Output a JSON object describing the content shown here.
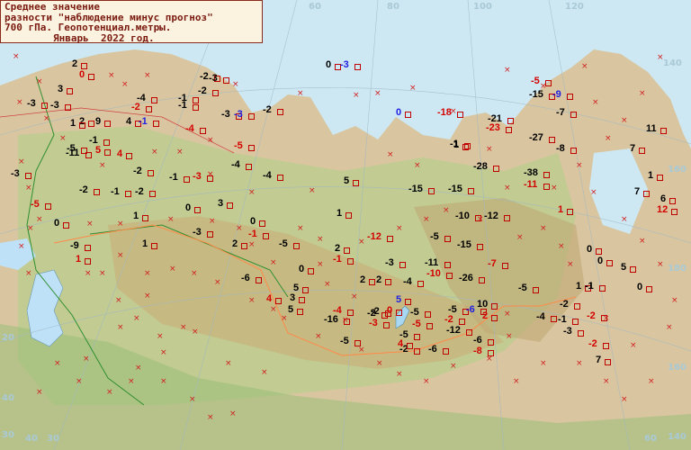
{
  "legend": {
    "line1": "Среднее значение",
    "line2": "разности \"наблюдение минус прогноз\"",
    "line3": "700 гПа. Геопотенциал.метры.",
    "line4": "Январь  2022 год."
  },
  "coordinate_labels": [
    "60",
    "80",
    "100",
    "120",
    "140",
    "160",
    "180",
    "160",
    "140",
    "40",
    "30",
    "20",
    "30",
    "40",
    "60"
  ],
  "observations": [
    {
      "v": "2",
      "c": "black"
    },
    {
      "v": "0",
      "c": "red"
    },
    {
      "v": "3",
      "c": "black"
    },
    {
      "v": "-3",
      "c": "black"
    },
    {
      "v": "-2",
      "c": "black"
    },
    {
      "v": "-3",
      "c": "black"
    },
    {
      "v": "-2",
      "c": "black"
    },
    {
      "v": "-1",
      "c": "black"
    },
    {
      "v": "-4",
      "c": "black"
    },
    {
      "v": "-3",
      "c": "black"
    },
    {
      "v": "2",
      "c": "black"
    },
    {
      "v": "9",
      "c": "black"
    },
    {
      "v": "4",
      "c": "black"
    },
    {
      "v": "-1",
      "c": "blue"
    },
    {
      "v": "-2",
      "c": "red"
    },
    {
      "v": "-1",
      "c": "black"
    },
    {
      "v": "-4",
      "c": "red"
    },
    {
      "v": "-3",
      "c": "black"
    },
    {
      "v": "-3",
      "c": "blue"
    },
    {
      "v": "-2",
      "c": "black"
    },
    {
      "v": "0",
      "c": "black"
    },
    {
      "v": "-3",
      "c": "blue"
    },
    {
      "v": "-18",
      "c": "red"
    },
    {
      "v": "0",
      "c": "blue"
    },
    {
      "v": "-1",
      "c": "black"
    },
    {
      "v": "-1",
      "c": "black"
    },
    {
      "v": "5",
      "c": "red"
    },
    {
      "v": "-5",
      "c": "black"
    },
    {
      "v": "1",
      "c": "black"
    },
    {
      "v": "-11",
      "c": "black"
    },
    {
      "v": "4",
      "c": "red"
    },
    {
      "v": "-2",
      "c": "black"
    },
    {
      "v": "-1",
      "c": "black"
    },
    {
      "v": "-3",
      "c": "red"
    },
    {
      "v": "-4",
      "c": "black"
    },
    {
      "v": "-4",
      "c": "black"
    },
    {
      "v": "-5",
      "c": "red"
    },
    {
      "v": "-2",
      "c": "black"
    },
    {
      "v": "-1",
      "c": "black"
    },
    {
      "v": "-2",
      "c": "black"
    },
    {
      "v": "1",
      "c": "black"
    },
    {
      "v": "0",
      "c": "black"
    },
    {
      "v": "3",
      "c": "black"
    },
    {
      "v": "-5",
      "c": "red"
    },
    {
      "v": "5",
      "c": "black"
    },
    {
      "v": "0",
      "c": "black"
    },
    {
      "v": "-3",
      "c": "black"
    },
    {
      "v": "0",
      "c": "black"
    },
    {
      "v": "1",
      "c": "black"
    },
    {
      "v": "-1",
      "c": "red"
    },
    {
      "v": "-3",
      "c": "black"
    },
    {
      "v": "-9",
      "c": "black"
    },
    {
      "v": "1",
      "c": "red"
    },
    {
      "v": "2",
      "c": "black"
    },
    {
      "v": "-5",
      "c": "black"
    },
    {
      "v": "1",
      "c": "black"
    },
    {
      "v": "0",
      "c": "black"
    },
    {
      "v": "-6",
      "c": "black"
    },
    {
      "v": "5",
      "c": "black"
    },
    {
      "v": "4",
      "c": "red"
    },
    {
      "v": "3",
      "c": "black"
    },
    {
      "v": "5",
      "c": "black"
    },
    {
      "v": "2",
      "c": "black"
    },
    {
      "v": "-1",
      "c": "red"
    },
    {
      "v": "2",
      "c": "black"
    },
    {
      "v": "-2",
      "c": "black"
    },
    {
      "v": "-12",
      "c": "red"
    },
    {
      "v": "-3",
      "c": "black"
    },
    {
      "v": "-4",
      "c": "red"
    },
    {
      "v": "-16",
      "c": "black"
    },
    {
      "v": "-2",
      "c": "black"
    },
    {
      "v": "-3",
      "c": "red"
    },
    {
      "v": "0",
      "c": "red"
    },
    {
      "v": "5",
      "c": "blue"
    },
    {
      "v": "-5",
      "c": "black"
    },
    {
      "v": "-11",
      "c": "black"
    },
    {
      "v": "-10",
      "c": "red"
    },
    {
      "v": "-26",
      "c": "black"
    },
    {
      "v": "-15",
      "c": "black"
    },
    {
      "v": "-15",
      "c": "black"
    },
    {
      "v": "-15",
      "c": "black"
    },
    {
      "v": "-5",
      "c": "black"
    },
    {
      "v": "-10",
      "c": "black"
    },
    {
      "v": "-12",
      "c": "black"
    },
    {
      "v": "-7",
      "c": "red"
    },
    {
      "v": "-28",
      "c": "black"
    },
    {
      "v": "-38",
      "c": "black"
    },
    {
      "v": "-11",
      "c": "red"
    },
    {
      "v": "-27",
      "c": "black"
    },
    {
      "v": "-8",
      "c": "black"
    },
    {
      "v": "-21",
      "c": "black"
    },
    {
      "v": "-23",
      "c": "red"
    },
    {
      "v": "-5",
      "c": "red"
    },
    {
      "v": "-15",
      "c": "black"
    },
    {
      "v": "-9",
      "c": "blue"
    },
    {
      "v": "-7",
      "c": "black"
    },
    {
      "v": "1",
      "c": "black"
    },
    {
      "v": "11",
      "c": "black"
    },
    {
      "v": "7",
      "c": "black"
    },
    {
      "v": "1",
      "c": "black"
    },
    {
      "v": "7",
      "c": "black"
    },
    {
      "v": "6",
      "c": "black"
    },
    {
      "v": "12",
      "c": "red"
    },
    {
      "v": "1",
      "c": "red"
    },
    {
      "v": "0",
      "c": "black"
    },
    {
      "v": "0",
      "c": "black"
    },
    {
      "v": "5",
      "c": "black"
    },
    {
      "v": "1",
      "c": "black"
    },
    {
      "v": "0",
      "c": "black"
    },
    {
      "v": "-1",
      "c": "black"
    },
    {
      "v": "-2",
      "c": "black"
    },
    {
      "v": "-2",
      "c": "red"
    },
    {
      "v": "-1",
      "c": "black"
    },
    {
      "v": "-3",
      "c": "black"
    },
    {
      "v": "-2",
      "c": "red"
    },
    {
      "v": "7",
      "c": "black"
    },
    {
      "v": "-5",
      "c": "black"
    },
    {
      "v": "-4",
      "c": "black"
    },
    {
      "v": "-5",
      "c": "black"
    },
    {
      "v": "-6",
      "c": "blue"
    },
    {
      "v": "10",
      "c": "black"
    },
    {
      "v": "-2",
      "c": "red"
    },
    {
      "v": "2",
      "c": "red"
    },
    {
      "v": "-12",
      "c": "black"
    },
    {
      "v": "-6",
      "c": "black"
    },
    {
      "v": "-8",
      "c": "red"
    },
    {
      "v": "-5",
      "c": "black"
    },
    {
      "v": "-2",
      "c": "black"
    },
    {
      "v": "-6",
      "c": "black"
    },
    {
      "v": "4",
      "c": "red"
    },
    {
      "v": "-5",
      "c": "black"
    },
    {
      "v": "-5",
      "c": "red"
    },
    {
      "v": "-1",
      "c": "black"
    },
    {
      "v": "2",
      "c": "black"
    },
    {
      "v": "-4",
      "c": "black"
    }
  ]
}
